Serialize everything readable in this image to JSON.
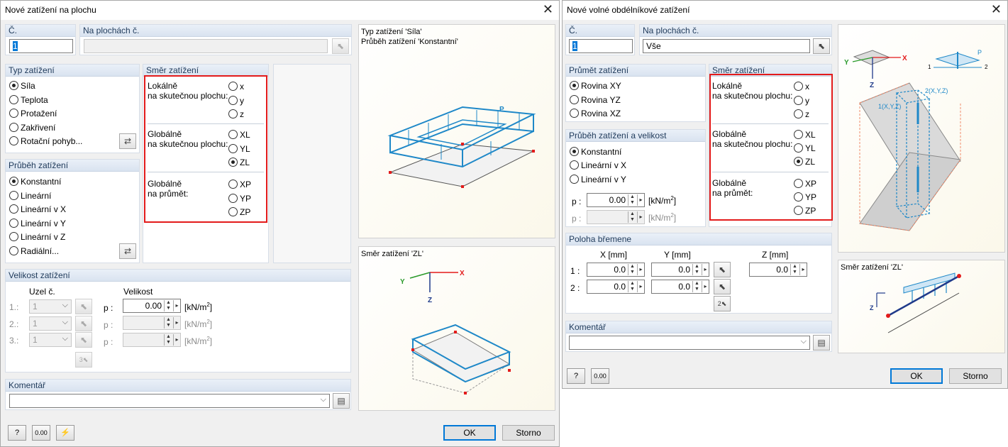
{
  "left": {
    "title": "Nové zatížení na plochu",
    "no_label": "Č.",
    "no_value": "1",
    "surfaces_label": "Na plochách č.",
    "surfaces_value": "",
    "load_type": {
      "header": "Typ zatížení",
      "options": [
        "Síla",
        "Teplota",
        "Protažení",
        "Zakřivení",
        "Rotační pohyb..."
      ],
      "selected": 0
    },
    "distribution": {
      "header": "Průběh zatížení",
      "options": [
        "Konstantní",
        "Lineární",
        "Lineární v X",
        "Lineární v Y",
        "Lineární v Z",
        "Radiální..."
      ],
      "selected": 0
    },
    "direction": {
      "header": "Směr zatížení",
      "local_label_1": "Lokálně",
      "local_label_2": "na skutečnou plochu:",
      "local_opts": [
        "x",
        "y",
        "z"
      ],
      "global_label_1": "Globálně",
      "global_label_2": "na skutečnou plochu:",
      "global_opts": [
        "XL",
        "YL",
        "ZL"
      ],
      "proj_label_1": "Globálně",
      "proj_label_2": "na průmět:",
      "proj_opts": [
        "XP",
        "YP",
        "ZP"
      ],
      "selected": "ZL"
    },
    "magnitude": {
      "header": "Velikost zatížení",
      "node_label": "Uzel č.",
      "value_label": "Velikost",
      "rows": [
        {
          "idx": "1.:",
          "node": "1",
          "p": "p :",
          "value": "0.00",
          "unit_pre": "[kN/m",
          "unit_sup": "2",
          "unit_post": "]"
        },
        {
          "idx": "2.:",
          "node": "1",
          "p": "p :",
          "value": "",
          "unit_pre": "[kN/m",
          "unit_sup": "2",
          "unit_post": "]"
        },
        {
          "idx": "3.:",
          "node": "1",
          "p": "p :",
          "value": "",
          "unit_pre": "[kN/m",
          "unit_sup": "2",
          "unit_post": "]"
        }
      ]
    },
    "comment": {
      "header": "Komentář",
      "value": ""
    },
    "preview_top": {
      "line1": "Typ zatížení 'Síla'",
      "line2": "Průběh zatížení 'Konstantní'",
      "load_label": "P"
    },
    "preview_bottom": {
      "title": "Směr zatížení 'ZL'",
      "x": "X",
      "y": "Y",
      "z": "Z"
    },
    "ok": "OK",
    "cancel": "Storno"
  },
  "right": {
    "title": "Nové volné obdélníkové zatížení",
    "no_label": "Č.",
    "no_value": "1",
    "surfaces_label": "Na plochách č.",
    "surfaces_value": "Vše",
    "projection": {
      "header": "Průmět zatížení",
      "options": [
        "Rovina XY",
        "Rovina YZ",
        "Rovina XZ"
      ],
      "selected": 0
    },
    "distribution": {
      "header": "Průběh zatížení a velikost",
      "options": [
        "Konstantní",
        "Lineární v X",
        "Lineární v Y"
      ],
      "selected": 0,
      "p_rows": [
        {
          "label": "p :",
          "value": "0.00",
          "unit_pre": "[kN/m",
          "unit_sup": "2",
          "unit_post": "]"
        },
        {
          "label": "p :",
          "value": "",
          "unit_pre": "[kN/m",
          "unit_sup": "2",
          "unit_post": "]"
        }
      ]
    },
    "direction": {
      "header": "Směr zatížení",
      "local_label_1": "Lokálně",
      "local_label_2": "na skutečnou plochu:",
      "local_opts": [
        "x",
        "y",
        "z"
      ],
      "global_label_1": "Globálně",
      "global_label_2": "na skutečnou plochu:",
      "global_opts": [
        "XL",
        "YL",
        "ZL"
      ],
      "proj_label_1": "Globálně",
      "proj_label_2": "na průmět:",
      "proj_opts": [
        "XP",
        "YP",
        "ZP"
      ],
      "selected": "ZL"
    },
    "position": {
      "header": "Poloha břemene",
      "x_col": "X  [mm]",
      "y_col": "Y  [mm]",
      "z_col": "Z  [mm]",
      "rows": [
        {
          "idx": "1 :",
          "x": "0.0",
          "y": "0.0",
          "z": "0.0"
        },
        {
          "idx": "2 :",
          "x": "0.0",
          "y": "0.0"
        }
      ]
    },
    "comment": {
      "header": "Komentář",
      "value": ""
    },
    "preview_top": {
      "x": "X",
      "y": "Y",
      "z": "Z",
      "p": "P",
      "n1": "1",
      "n2": "2",
      "pt1": "1(X,Y,Z)",
      "pt2": "2(X,Y,Z)"
    },
    "preview_bottom": {
      "title": "Směr zatížení 'ZL'",
      "z": "Z"
    },
    "ok": "OK",
    "cancel": "Storno"
  },
  "icons": {
    "help": "help-icon",
    "units": "units-icon",
    "calc": "calculator-icon",
    "pick": "pick-cursor-icon"
  },
  "colors": {
    "highlight": "#e31b1b",
    "load": "#1e88c8",
    "accent": "#0078d7"
  },
  "units_icon_text": "0.00"
}
